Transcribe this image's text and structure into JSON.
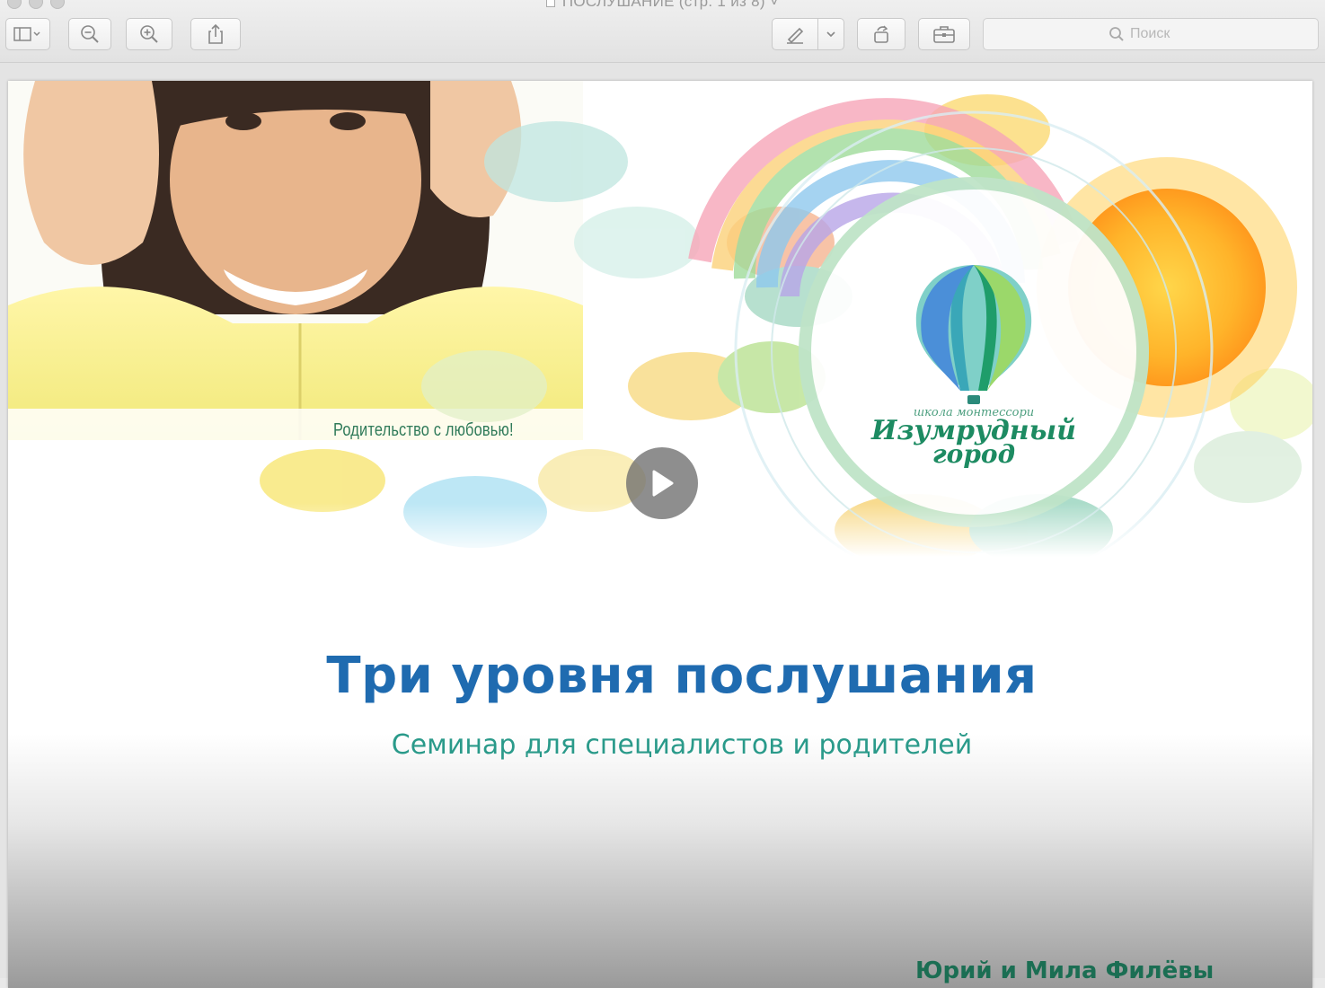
{
  "window": {
    "title": "ПОСЛУШАНИЕ (стр. 1 из 8)",
    "title_chevron": "˅"
  },
  "toolbar": {
    "buttons": [
      "sidebar-icon",
      "zoom-out-icon",
      "zoom-in-icon",
      "share-icon",
      "markup-pen-icon",
      "chevron-down-icon",
      "rotate-icon",
      "toolbox-icon"
    ],
    "search_placeholder": "Поиск"
  },
  "banner": {
    "slogan": "Родительство с любовью!",
    "logo_top": "школа монтессори",
    "logo_main": "Изумрудный",
    "logo_sub": "город"
  },
  "slide": {
    "title": "Три уровня послушания",
    "subtitle": "Семинар для специалистов и родителей",
    "authors": "Юрий и Мила Филёвы"
  },
  "colors": {
    "title": "#1f6bb0",
    "subtitle": "#2a9a8a",
    "logo": "#1d8b62",
    "play_button": "#6e6e6e"
  }
}
